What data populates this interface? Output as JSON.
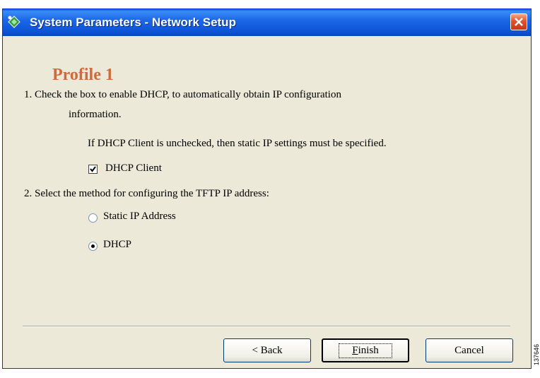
{
  "window": {
    "title": "System Parameters - Network Setup"
  },
  "content": {
    "profile_title": "Profile 1",
    "step1_line1": "1. Check the box to enable DHCP, to automatically obtain IP configuration",
    "step1_line2": "information.",
    "step1_note": "If DHCP Client is unchecked, then static IP settings must be specified.",
    "dhcp_client_label": "DHCP Client",
    "dhcp_client_checked": true,
    "step2_line": "2. Select the method for configuring the TFTP IP address:",
    "radio_options": [
      {
        "label": "Static  IP  Address",
        "selected": false
      },
      {
        "label": "DHCP",
        "selected": true
      }
    ]
  },
  "footer": {
    "back_label": "< Back",
    "finish_label_u": "F",
    "finish_label_rest": "inish",
    "cancel_label": "Cancel"
  },
  "side_mark": "137646",
  "icons": {
    "app": "network-setup-icon",
    "close": "close-icon"
  },
  "colors": {
    "title_bar": "#0d52d6",
    "profile_title": "#d06a3a",
    "close_button": "#e0532a",
    "dialog_bg": "#ece9d8"
  }
}
